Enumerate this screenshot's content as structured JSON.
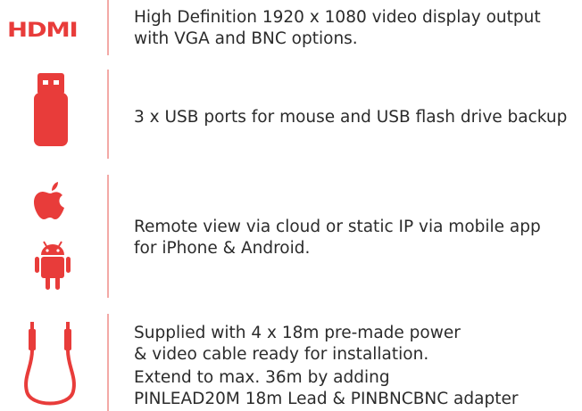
{
  "colors": {
    "accent": "#e83c3a",
    "divider": "#f3a9a6",
    "text": "#2b2b2b"
  },
  "features": [
    {
      "icon": "hdmi-logo-icon",
      "icon_text": "HDMI",
      "lines": [
        "High Definition 1920 x 1080 video display output",
        "with VGA and BNC options."
      ]
    },
    {
      "icon": "usb-flash-drive-icon",
      "lines": [
        "3 x USB ports for mouse and USB flash drive backup"
      ]
    },
    {
      "icon": "apple-android-icon",
      "lines": [
        "Remote view via cloud or static IP via mobile app",
        "for iPhone & Android."
      ]
    },
    {
      "icon": "video-cable-icon",
      "lines": [
        "Supplied with 4 x 18m pre-made power",
        "& video cable ready for installation.",
        "Extend to max. 36m by adding",
        "PINLEAD20M 18m Lead & PINBNCBNC adapter"
      ]
    }
  ]
}
